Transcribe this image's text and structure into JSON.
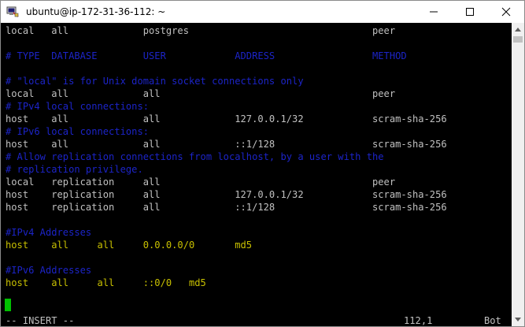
{
  "window": {
    "title": "ubuntu@ip-172-31-36-112: ~",
    "controls": {
      "minimize": "—",
      "maximize": "☐",
      "close": "✕"
    }
  },
  "terminal": {
    "lines": [
      {
        "text": "local   all             postgres                                peer",
        "color": "white"
      },
      {
        "text": "",
        "color": "white"
      },
      {
        "text": "# TYPE  DATABASE        USER            ADDRESS                 METHOD",
        "color": "blue"
      },
      {
        "text": "",
        "color": "white"
      },
      {
        "text": "# \"local\" is for Unix domain socket connections only",
        "color": "blue"
      },
      {
        "text": "local   all             all                                     peer",
        "color": "white"
      },
      {
        "text": "# IPv4 local connections:",
        "color": "blue"
      },
      {
        "text": "host    all             all             127.0.0.1/32            scram-sha-256",
        "color": "white"
      },
      {
        "text": "# IPv6 local connections:",
        "color": "blue"
      },
      {
        "text": "host    all             all             ::1/128                 scram-sha-256",
        "color": "white"
      },
      {
        "text": "# Allow replication connections from localhost, by a user with the",
        "color": "blue"
      },
      {
        "text": "# replication privilege.",
        "color": "blue"
      },
      {
        "text": "local   replication     all                                     peer",
        "color": "white"
      },
      {
        "text": "host    replication     all             127.0.0.1/32            scram-sha-256",
        "color": "white"
      },
      {
        "text": "host    replication     all             ::1/128                 scram-sha-256",
        "color": "white"
      },
      {
        "text": "",
        "color": "white"
      },
      {
        "text": "#IPv4 Addresses",
        "color": "blue"
      },
      {
        "text": "host    all     all     0.0.0.0/0       md5",
        "color": "yellow"
      },
      {
        "text": "",
        "color": "white"
      },
      {
        "text": "#IPv6 Addresses",
        "color": "blue"
      },
      {
        "text": "host    all     all     ::0/0   md5",
        "color": "yellow"
      }
    ],
    "status": {
      "mode": "-- INSERT --",
      "position": "112,1",
      "scroll": "Bot"
    }
  },
  "colors": {
    "background": "#000000",
    "text": "#c0c0c0",
    "comment": "#1c24c8",
    "highlight": "#c8c000",
    "cursor": "#00c000"
  }
}
